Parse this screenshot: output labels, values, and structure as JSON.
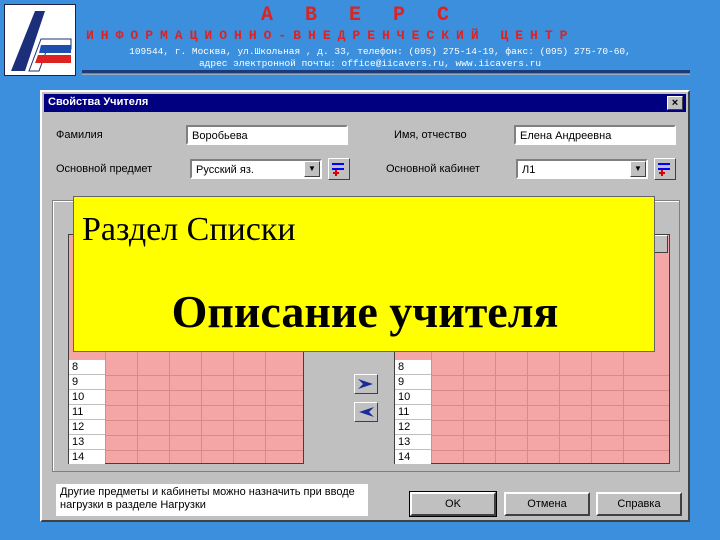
{
  "header": {
    "brand": "А В Е Р С",
    "center_name": "ИНФОРМАЦИОННО-ВНЕДРЕНЧЕСКИЙ ЦЕНТР",
    "address_line1": "109544, г. Москва, ул.Школьная , д. 33,  телефон:  (095) 275-14-19, факс: (095) 275-70-60,",
    "address_line2": "адрес электронной почты: office@iicavers.ru, www.iicavers.ru",
    "logo_icon": "avers-logo-icon"
  },
  "dialog": {
    "title": "Свойства Учителя",
    "close_label": "×",
    "surname_label": "Фамилия",
    "surname_value": "Воробьева",
    "name_label": "Имя, отчество",
    "name_value": "Елена Андреевна",
    "subject_label": "Основной предмет",
    "subject_value": "Русский яз.",
    "room_label": "Основной кабинет",
    "room_value": "Л1",
    "grid_rows": [
      "8",
      "9",
      "10",
      "11",
      "12",
      "13",
      "14"
    ],
    "note": "Другие предметы и кабинеты можно назначить при вводе нагрузки в разделе Нагрузки",
    "ok_label": "OK",
    "cancel_label": "Отмена",
    "help_label": "Справка"
  },
  "overlay": {
    "title": "Раздел Списки",
    "subtitle": "Описание учителя"
  },
  "colors": {
    "background": "#3b8fdc",
    "titlebar": "#000080",
    "grid_cell": "#f4a6a6",
    "overlay": "#ffff00"
  }
}
